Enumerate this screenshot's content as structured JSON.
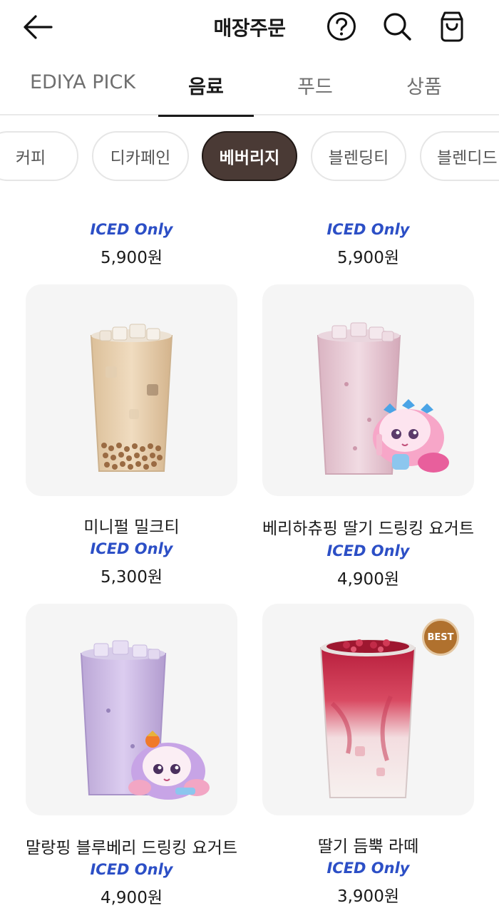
{
  "header": {
    "title": "매장주문",
    "icons": [
      "back-arrow-icon",
      "help-icon",
      "search-icon",
      "cart-icon"
    ]
  },
  "main_tabs": [
    {
      "label": "EDIYA PICK",
      "active": false
    },
    {
      "label": "음료",
      "active": true
    },
    {
      "label": "푸드",
      "active": false
    },
    {
      "label": "상품",
      "active": false
    }
  ],
  "categories": [
    {
      "label": "커피",
      "active": false
    },
    {
      "label": "디카페인",
      "active": false
    },
    {
      "label": "베버리지",
      "active": true
    },
    {
      "label": "블렌딩티",
      "active": false
    },
    {
      "label": "블렌디드",
      "active": false
    }
  ],
  "partial_row": [
    {
      "tag": "ICED Only",
      "price": "5,900원"
    },
    {
      "tag": "ICED Only",
      "price": "5,900원"
    }
  ],
  "products": [
    {
      "name": "미니펄 밀크티",
      "tag": "ICED Only",
      "price": "5,300원",
      "badge": ""
    },
    {
      "name": "베리하츄핑 딸기 드링킹 요거트",
      "tag": "ICED Only",
      "price": "4,900원",
      "badge": ""
    },
    {
      "name": "말랑핑 블루베리 드링킹 요거트",
      "tag": "ICED Only",
      "price": "4,900원",
      "badge": ""
    },
    {
      "name": "딸기 듬뿍 라떼",
      "tag": "ICED Only",
      "price": "3,900원",
      "badge": "BEST"
    }
  ],
  "colors": {
    "accent_chip": "#4a3a35",
    "iced_tag": "#2c4fc6",
    "card_bg": "#f5f5f5",
    "best_badge": "#b0712e"
  }
}
